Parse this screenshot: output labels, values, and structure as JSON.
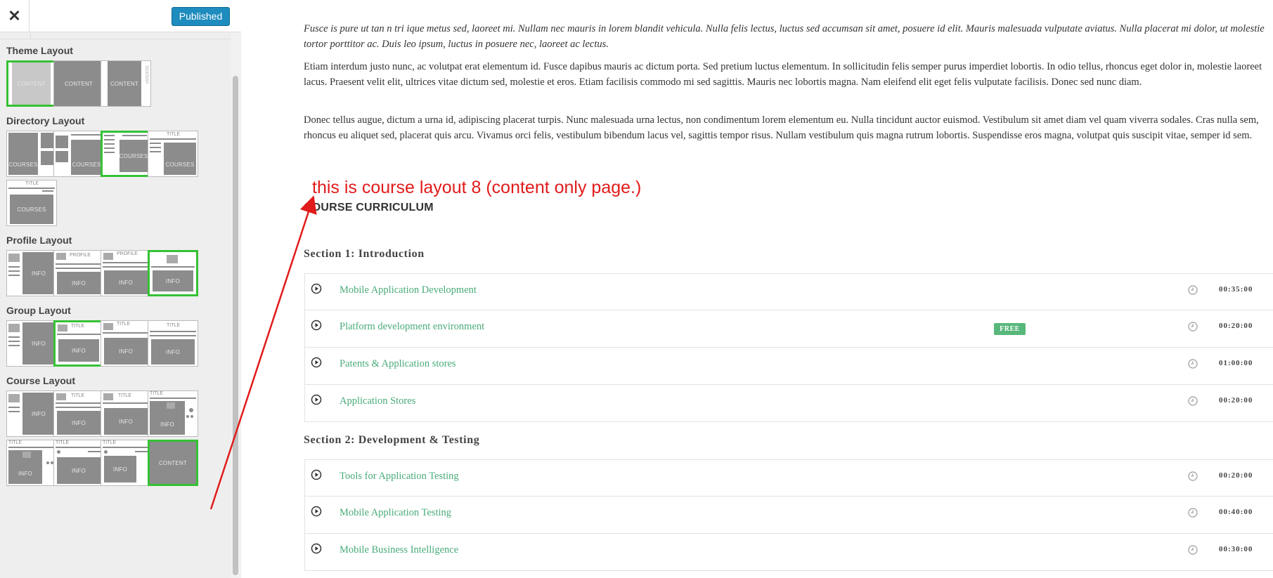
{
  "header": {
    "close_label": "✕",
    "publish_label": "Published"
  },
  "sidebar": {
    "sections": [
      {
        "title": "Theme Layout"
      },
      {
        "title": "Directory Layout"
      },
      {
        "title": "Profile Layout"
      },
      {
        "title": "Group Layout"
      },
      {
        "title": "Course Layout"
      }
    ],
    "labels": {
      "content": "CONTENT",
      "courses": "COURSES",
      "info": "INFO",
      "profile": "PROFILE",
      "title": "TITLE",
      "sidebar": "SIDEBAR"
    }
  },
  "main": {
    "para_intro": "Fusce is pure ut tan n tri ique metus sed, laoreet mi. Nullam nec mauris in lorem blandit vehicula. Nulla felis lectus, luctus sed accumsan sit amet, posuere id elit. Mauris malesuada vulputate aviatus. Nulla placerat mi dolor, ut molestie tortor porttitor ac. Duis leo ipsum, luctus in posuere nec, laoreet ac lectus.",
    "para_1": "Etiam interdum justo nunc, ac volutpat erat elementum id. Fusce dapibus mauris ac dictum porta. Sed pretium luctus elementum. In sollicitudin felis semper purus imperdiet lobortis. In odio tellus, rhoncus eget dolor in, molestie laoreet lacus. Praesent velit elit, ultrices vitae dictum sed, molestie et eros. Etiam facilisis commodo mi sed sagittis. Mauris nec lobortis magna. Nam eleifend elit eget felis vulputate facilisis. Donec sed nunc diam.",
    "para_2": "Donec tellus augue, dictum a urna id, adipiscing placerat turpis. Nunc malesuada urna lectus, non condimentum lorem elementum eu. Nulla tincidunt auctor euismod. Vestibulum sit amet diam vel quam viverra sodales. Cras nulla sem, rhoncus eu aliquet sed, placerat quis arcu. Vivamus orci felis, vestibulum bibendum lacus vel, sagittis tempor risus. Nullam vestibulum quis magna rutrum lobortis. Suspendisse eros magna, volutpat quis suscipit vitae, semper id sem.",
    "annotation": "this is course layout 8 (content only page.)",
    "curriculum_title": "COURSE CURRICULUM",
    "sections": [
      {
        "title": "Section 1: Introduction",
        "lessons": [
          {
            "title": "Mobile Application Development",
            "duration": "00:35:00"
          },
          {
            "title": "Platform development environment",
            "badge": "FREE",
            "duration": "00:20:00"
          },
          {
            "title": "Patents & Application stores",
            "duration": "01:00:00"
          },
          {
            "title": "Application Stores",
            "duration": "00:20:00"
          }
        ]
      },
      {
        "title": "Section 2: Development & Testing",
        "lessons": [
          {
            "title": "Tools for Application Testing",
            "duration": "00:20:00"
          },
          {
            "title": "Mobile Application Testing",
            "duration": "00:40:00"
          },
          {
            "title": "Mobile Business Intelligence",
            "duration": "00:30:00"
          }
        ]
      }
    ]
  },
  "colors": {
    "accent_green": "#35c135",
    "link_green": "#49ab79",
    "publish_blue": "#1e8cbe",
    "annotation_red": "#e11b1b"
  }
}
